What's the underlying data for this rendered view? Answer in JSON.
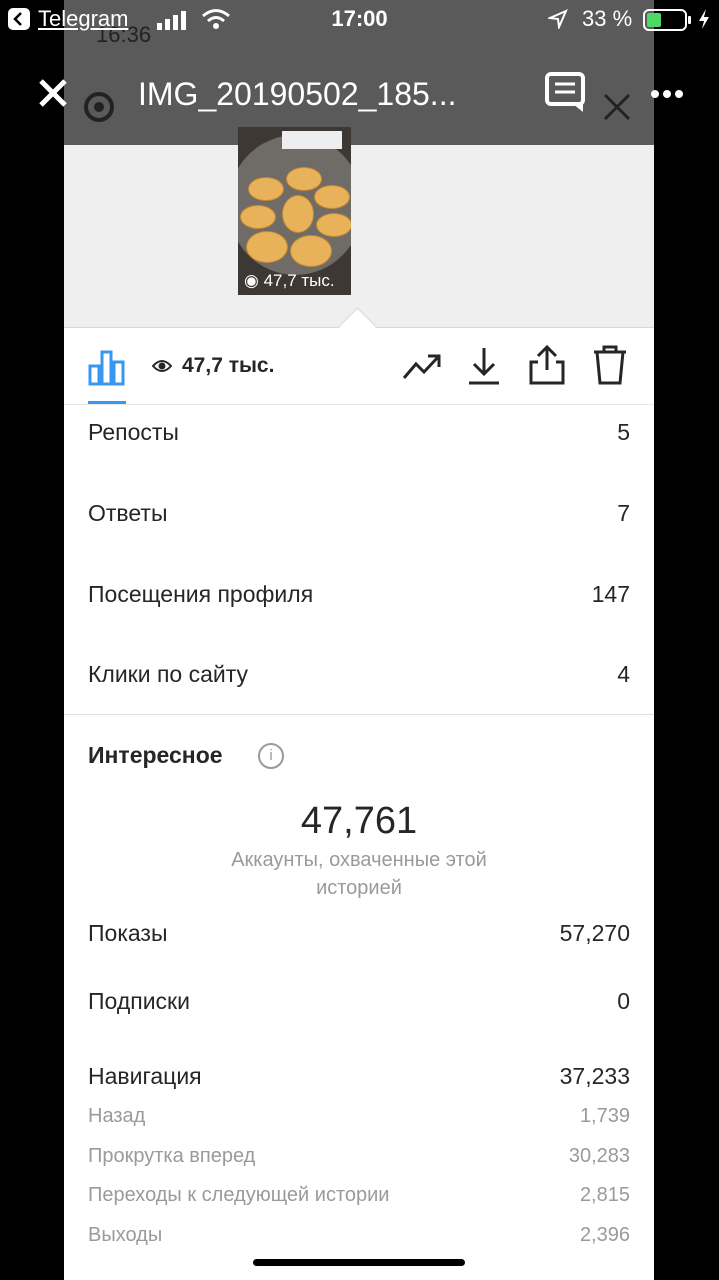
{
  "status_bar": {
    "back_app": "Telegram",
    "time": "17:00",
    "battery": "33 %"
  },
  "viewer": {
    "file_title": "IMG_20190502_185..."
  },
  "underlying_status": {
    "time": "16:36"
  },
  "preview": {
    "views": "47,7 тыс."
  },
  "toolbar": {
    "views": "47,7 тыс."
  },
  "stats": [
    {
      "label": "Репосты",
      "value": "5"
    },
    {
      "label": "Ответы",
      "value": "7"
    },
    {
      "label": "Посещения профиля",
      "value": "147"
    },
    {
      "label": "Клики по сайту",
      "value": "4"
    }
  ],
  "discovery": {
    "title": "Интересное",
    "reach": "47,761",
    "reach_caption": "Аккаунты, охваченные этой историей",
    "rows": [
      {
        "label": "Показы",
        "value": "57,270"
      },
      {
        "label": "Подписки",
        "value": "0"
      },
      {
        "label": "Навигация",
        "value": "37,233"
      }
    ],
    "nav_rows": [
      {
        "label": "Назад",
        "value": "1,739"
      },
      {
        "label": "Прокрутка вперед",
        "value": "30,283"
      },
      {
        "label": "Переходы к следующей истории",
        "value": "2,815"
      },
      {
        "label": "Выходы",
        "value": "2,396"
      }
    ]
  },
  "colors": {
    "accent": "#3897f0",
    "text": "#262626",
    "muted": "#9a9a9a"
  }
}
